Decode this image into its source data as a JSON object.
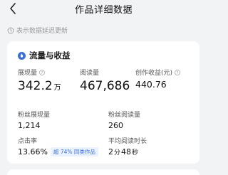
{
  "header": {
    "title": "作品详细数据"
  },
  "notice": {
    "text": "表示数据延迟更新"
  },
  "card": {
    "title": "流量与收益",
    "metrics": {
      "impressions": {
        "label": "展现量",
        "value": "342.2",
        "unit": "万"
      },
      "reads": {
        "label": "阅读量",
        "value": "467,686"
      },
      "earnings": {
        "label": "创作收益(元)",
        "value": "440.76"
      },
      "fan_impressions": {
        "label": "粉丝展现量",
        "value": "1,214"
      },
      "fan_reads": {
        "label": "粉丝阅读量",
        "value": "260"
      },
      "ctr": {
        "label": "点击率",
        "value": "13.66%",
        "badge": "超 74% 同类作品"
      },
      "avg_read_time": {
        "label": "平均阅读时长",
        "minutes": "2",
        "min_unit": "分",
        "seconds": "48",
        "sec_unit": "秒"
      }
    }
  },
  "colors": {
    "accent": "#3b6fd8",
    "background": "#f2f3f5",
    "card": "#ffffff"
  }
}
